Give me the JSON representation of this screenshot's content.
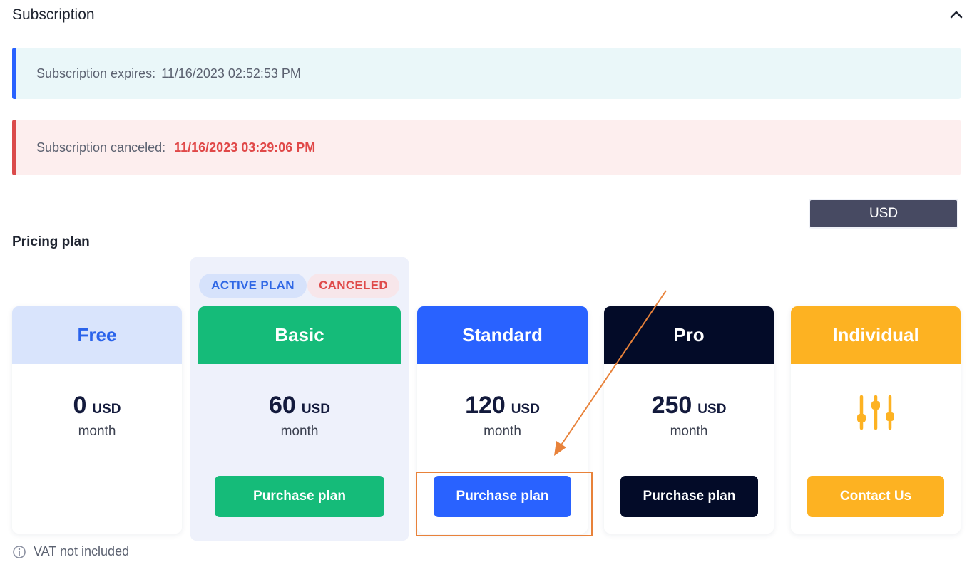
{
  "header": {
    "title": "Subscription"
  },
  "alerts": {
    "expires_label": "Subscription expires:",
    "expires_value": "11/16/2023 02:52:53 PM",
    "canceled_label": "Subscription canceled:",
    "canceled_value": "11/16/2023 03:29:06 PM"
  },
  "currency": {
    "selected": "USD"
  },
  "pricing": {
    "label": "Pricing plan",
    "badges": {
      "active": "ACTIVE PLAN",
      "canceled": "CANCELED"
    },
    "plans": [
      {
        "name": "Free",
        "amount": "0",
        "currency": "USD",
        "period": "month",
        "button": "",
        "header_bg": "#d9e4fc",
        "header_fg": "#2a63eb"
      },
      {
        "name": "Basic",
        "amount": "60",
        "currency": "USD",
        "period": "month",
        "button": "Purchase plan",
        "header_bg": "#15bb79",
        "header_fg": "#ffffff",
        "button_bg": "#15bb79"
      },
      {
        "name": "Standard",
        "amount": "120",
        "currency": "USD",
        "period": "month",
        "button": "Purchase plan",
        "header_bg": "#2962ff",
        "header_fg": "#ffffff",
        "button_bg": "#2962ff"
      },
      {
        "name": "Pro",
        "amount": "250",
        "currency": "USD",
        "period": "month",
        "button": "Purchase plan",
        "header_bg": "#030b28",
        "header_fg": "#ffffff",
        "button_bg": "#030b28"
      },
      {
        "name": "Individual",
        "button": "Contact Us",
        "header_bg": "#fdb222",
        "header_fg": "#ffffff",
        "button_bg": "#fdb222",
        "icon": "equalizer-icon"
      }
    ]
  },
  "footer": {
    "note": "VAT not included",
    "icon": "info-icon"
  },
  "annotation": {
    "color": "#e8823a"
  }
}
